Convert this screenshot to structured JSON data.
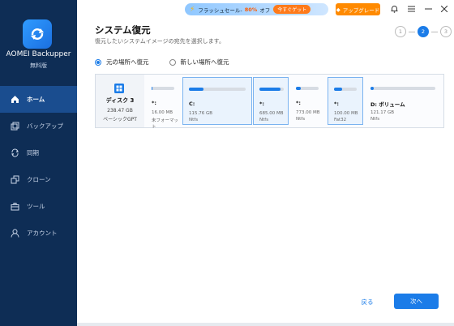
{
  "app": {
    "name": "AOMEI Backupper",
    "edition": "無料版"
  },
  "sidebar": {
    "items": [
      {
        "label": "ホーム",
        "icon": "home-icon",
        "active": true
      },
      {
        "label": "バックアップ",
        "icon": "backup-icon",
        "active": false
      },
      {
        "label": "同期",
        "icon": "sync-icon",
        "active": false
      },
      {
        "label": "クローン",
        "icon": "clone-icon",
        "active": false
      },
      {
        "label": "ツール",
        "icon": "tools-icon",
        "active": false
      },
      {
        "label": "アカウント",
        "icon": "account-icon",
        "active": false
      }
    ]
  },
  "topbar": {
    "promo_prefix": "フラッシュセール-",
    "promo_percent": "80%",
    "promo_suffix": "オフ",
    "promo_buy": "今すぐゲット",
    "upgrade": "アップグレード"
  },
  "page": {
    "title": "システム復元",
    "subtitle": "復元したいシステムイメージの宛先を選択します。",
    "steps": [
      "1",
      "2",
      "3"
    ],
    "active_step": 2
  },
  "options": {
    "original": "元の場所へ復元",
    "new": "新しい場所へ復元",
    "selected": "original"
  },
  "disk": {
    "name": "ディスク 3",
    "size": "238.47 GB",
    "type": "ベーシックGPT",
    "partitions": [
      {
        "label": "*:",
        "size": "16.00 MB",
        "fs": "未フォーマット",
        "used": 0.05,
        "selected": false
      },
      {
        "label": "C:",
        "size": "115.76 GB",
        "fs": "Ntfs",
        "used": 0.25,
        "selected": true
      },
      {
        "label": "*:",
        "size": "685.00 MB",
        "fs": "Ntfs",
        "used": 0.85,
        "selected": true
      },
      {
        "label": "*:",
        "size": "773.00 MB",
        "fs": "Ntfs",
        "used": 0.2,
        "selected": false
      },
      {
        "label": "*:",
        "size": "100.00 MB",
        "fs": "Fat32",
        "used": 0.35,
        "selected": true
      },
      {
        "label": "D: ボリューム",
        "size": "121.17 GB",
        "fs": "Ntfs",
        "used": 0.05,
        "selected": false
      }
    ]
  },
  "buttons": {
    "back": "戻る",
    "next": "次へ"
  },
  "colors": {
    "sidebar": "#0e2d55",
    "accent": "#1b7ce8",
    "promo": "#ff8a00"
  }
}
